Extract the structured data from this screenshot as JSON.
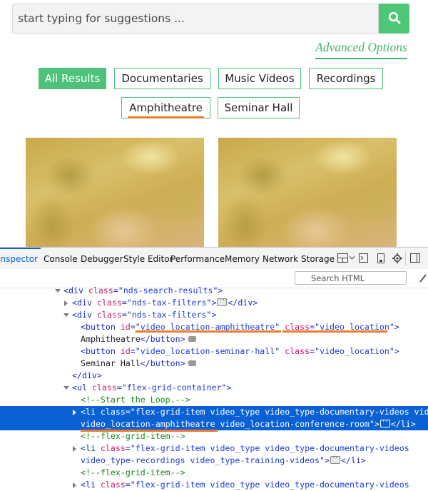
{
  "search": {
    "placeholder": "start typing for suggestions ...",
    "button_icon": "search-icon"
  },
  "advanced_options": "Advanced Options",
  "filters": [
    {
      "label": "All Results",
      "active": true
    },
    {
      "label": "Documentaries",
      "active": false
    },
    {
      "label": "Music Videos",
      "active": false
    },
    {
      "label": "Recordings",
      "active": false
    },
    {
      "label": "Amphitheatre",
      "active": false
    },
    {
      "label": "Seminar Hall",
      "active": false
    }
  ],
  "colors": {
    "accent": "#4ec27a",
    "highlight_underline": "#f07a2c",
    "devtools_selection": "#0a61d6"
  },
  "devtools": {
    "tabs": [
      "Inspector",
      "Console",
      "Debugger",
      "Style Editor",
      "Performance",
      "Memory",
      "Network",
      "Storage"
    ],
    "selected_tab": "Inspector",
    "search_placeholder": "Search HTML",
    "lines": {
      "l1": [
        "<div ",
        "class",
        "=\"",
        "nds-search-results",
        "\">"
      ],
      "l2": [
        "<div ",
        "class",
        "=\"",
        "nds-tax-filters",
        "\">",
        "</div>"
      ],
      "l3": [
        "<div ",
        "class",
        "=\"",
        "nds-tax-filters",
        "\">"
      ],
      "l4": [
        "<button ",
        "id",
        "=\"",
        "video_location-amphitheatre",
        "\" ",
        "class",
        "=\"",
        "video_location",
        "\">"
      ],
      "l5": [
        "Amphitheatre",
        "</button>"
      ],
      "l6": [
        "<button ",
        "id",
        "=\"",
        "video_location-seminar-hall",
        "\" ",
        "class",
        "=\"",
        "video_location",
        "\">"
      ],
      "l7": [
        "Seminar Hall",
        "</button>"
      ],
      "l8": [
        "</div>"
      ],
      "l9": [
        "<ul ",
        "class",
        "=\"",
        "flex-grid-container",
        "\">"
      ],
      "l10": [
        "<!--Start the Loop.-->"
      ],
      "l11": [
        "<li ",
        "class",
        "=\"flex-grid-item video_type video_type-documentary-videos vid"
      ],
      "l12": [
        "video_location-amphitheatre video_location-conference-room\">",
        "</li>"
      ],
      "l13": [
        "<!--flex-grid-item-->"
      ],
      "l14": [
        "<li ",
        "class",
        "=\"",
        "flex-grid-item video_type video_type-documentary-videos"
      ],
      "l15": [
        "video_type-recordings video_type-training-videos",
        "\">",
        "</li>"
      ],
      "l16": [
        "<!--flex-grid-item-->"
      ],
      "l17": [
        "<li ",
        "class",
        "=\"",
        "flex-grid-item video_type video_type-documentary-videos"
      ]
    }
  }
}
